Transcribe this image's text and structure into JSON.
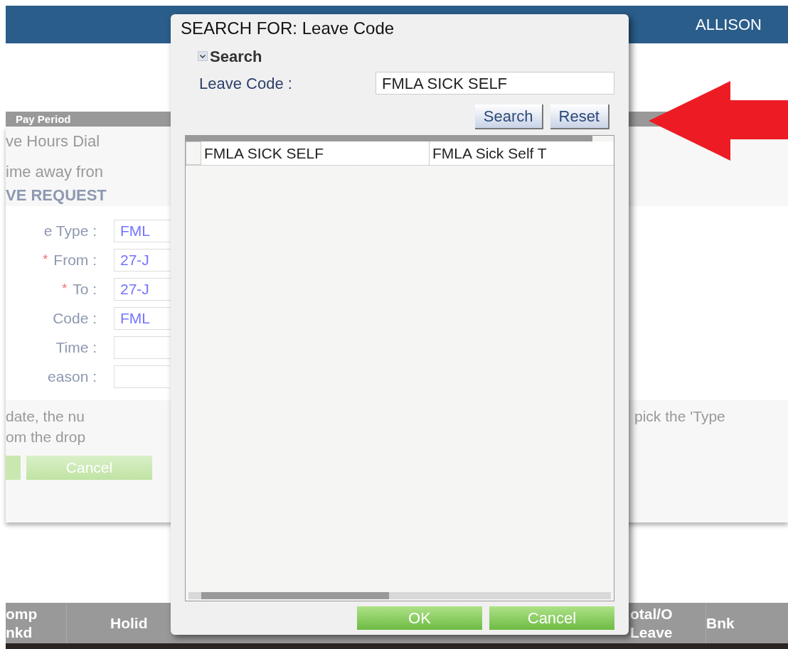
{
  "header": {
    "user": "ALLISON"
  },
  "table_top": {
    "column_1": "Pay Period"
  },
  "leave_panel": {
    "title": "ve Hours Dial",
    "intro": "ime away fron",
    "heading": "VE REQUEST",
    "fields": [
      {
        "label": "e Type :",
        "value": "FML"
      },
      {
        "marker": "*",
        "label": "From :",
        "value": "27-J"
      },
      {
        "marker": "*",
        "label": "To :",
        "value": "27-J"
      },
      {
        "label": "Code :",
        "value": "FML"
      },
      {
        "label": "Time :"
      },
      {
        "label": "eason :"
      }
    ],
    "notes": [
      {
        "left": "date, the nu",
        "right": "pick the 'Type"
      },
      {
        "left": "om the drop"
      }
    ],
    "cancel_button": "Cancel"
  },
  "bottom_table": {
    "columns": [
      {
        "label": "omp\nnkd"
      },
      {
        "label": "Holid"
      },
      {
        "label": "otal/O\nLeave"
      },
      {
        "label": "Bnk"
      }
    ]
  },
  "dialog": {
    "title": "SEARCH FOR: Leave Code",
    "section": {
      "label": "Search",
      "expanded": true
    },
    "field": {
      "label": "Leave Code :",
      "value": "FMLA SICK SELF"
    },
    "buttons": [
      "Search",
      "Reset"
    ],
    "results": [
      {
        "code": "FMLA SICK SELF",
        "description": "FMLA Sick Self T"
      }
    ],
    "footer_buttons": [
      "OK",
      "Cancel"
    ]
  }
}
